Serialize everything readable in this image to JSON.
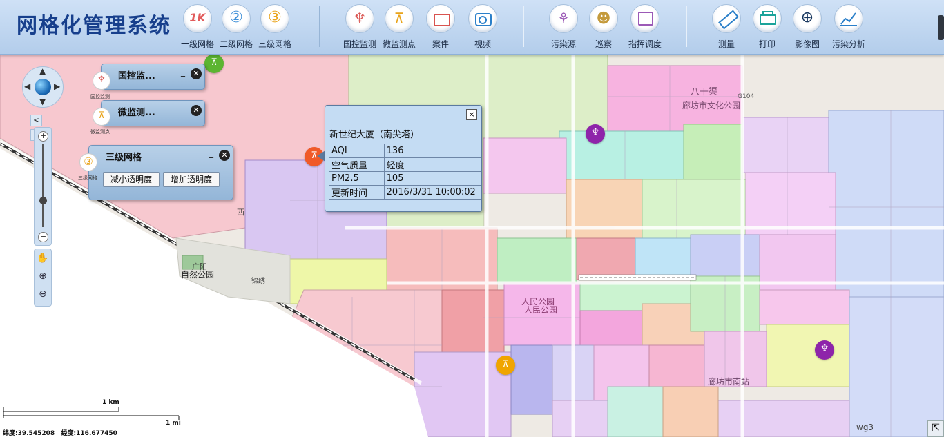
{
  "app_title": "网格化管理系统",
  "toolbar": [
    {
      "label": "一级网格",
      "icon": "grid-level1-icon",
      "color": "#e25b5b",
      "glyph": "1K"
    },
    {
      "label": "二级网格",
      "icon": "grid-level2-icon",
      "color": "#3d8fd8",
      "glyph": "②"
    },
    {
      "label": "三级网格",
      "icon": "grid-level3-icon",
      "color": "#e9a319",
      "glyph": "③"
    },
    {
      "label": "国控监测",
      "icon": "national-monitor-icon",
      "color": "#d9534f",
      "glyph": "♆"
    },
    {
      "label": "微监测点",
      "icon": "micro-monitor-icon",
      "color": "#e9a319",
      "glyph": "⊼"
    },
    {
      "label": "案件",
      "icon": "case-folder-icon",
      "color": "#d9534f",
      "glyph": "▭"
    },
    {
      "label": "视频",
      "icon": "video-icon",
      "color": "#2a7fc9",
      "glyph": "◉"
    },
    {
      "label": "污染源",
      "icon": "pollution-source-icon",
      "color": "#9b59b6",
      "glyph": "⚘"
    },
    {
      "label": "巡察",
      "icon": "patrol-icon",
      "color": "#c49a3c",
      "glyph": "☻"
    },
    {
      "label": "指挥调度",
      "icon": "dispatch-icon",
      "color": "#9b59b6",
      "glyph": "⌗"
    },
    {
      "label": "测量",
      "icon": "measure-icon",
      "color": "#2a7fc9",
      "glyph": "▱"
    },
    {
      "label": "打印",
      "icon": "print-icon",
      "color": "#1aa39a",
      "glyph": "▤"
    },
    {
      "label": "影像图",
      "icon": "satellite-image-icon",
      "color": "#17365e",
      "glyph": "⊕"
    },
    {
      "label": "污染分析",
      "icon": "pollution-analysis-icon",
      "color": "#2a7fc9",
      "glyph": "📈"
    }
  ],
  "layer_panels": [
    {
      "title": "国控监...",
      "minimize": "_",
      "icon_label": "国控监测"
    },
    {
      "title": "微监测...",
      "minimize": "_",
      "icon_label": "微监测点"
    },
    {
      "title": "三级网格",
      "minimize": "_",
      "icon_label": "三级网格"
    }
  ],
  "opacity_buttons": {
    "decrease": "减小透明度",
    "increase": "增加透明度"
  },
  "popup": {
    "title": "新世纪大厦（南尖塔）",
    "close": "×",
    "rows": [
      {
        "key": "AQI",
        "value": "136"
      },
      {
        "key": "空气质量",
        "value": "轻度"
      },
      {
        "key": "PM2.5",
        "value": "105"
      },
      {
        "key": "更新时间",
        "value": "2016/3/31 10:00:02"
      }
    ]
  },
  "map_labels": [
    "八干渠",
    "廊坊市文化公园",
    "G104",
    "西",
    "广阳",
    "自然公园",
    "锦绣",
    "人民公园",
    "人民公园",
    "廊坊市南站"
  ],
  "scale": {
    "km": "1 km",
    "mi": "1 mi"
  },
  "coords": {
    "lat_label": "纬度:",
    "lat": "39.545208",
    "lon_label": "经度:",
    "lon": "116.677450"
  },
  "layer_tag": "wg3",
  "colors": {
    "header_bg": "#bcd3ee",
    "title": "#173f8c",
    "national_marker": "#8e24aa",
    "micro_marker": "#f0a500",
    "active_marker": "#f05a28",
    "green_marker": "#5cb531"
  }
}
